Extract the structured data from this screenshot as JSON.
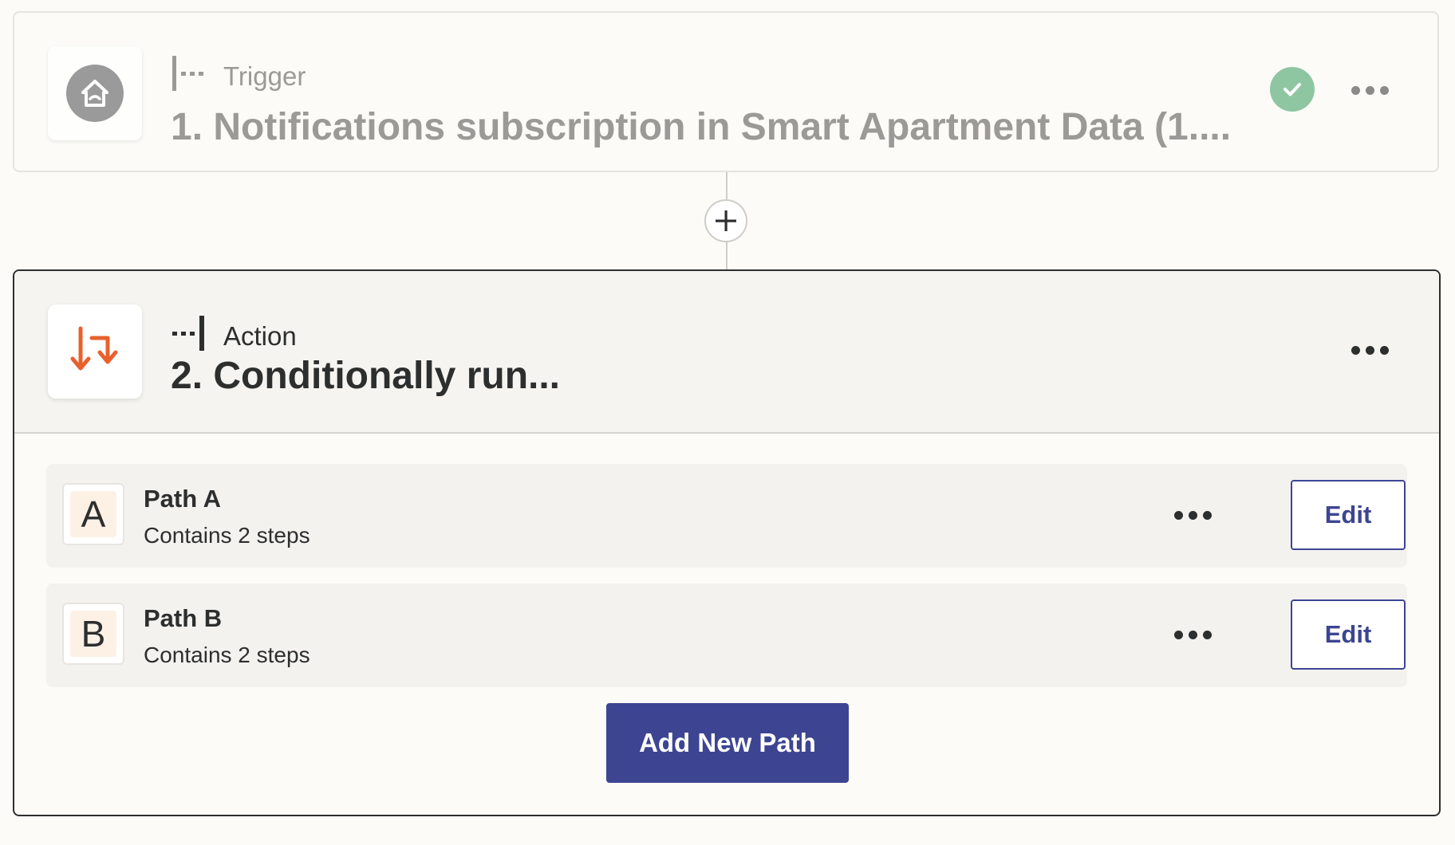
{
  "trigger": {
    "kind_label": "Trigger",
    "title": "1. Notifications subscription in Smart Apartment Data (1....",
    "app_icon": "home-icon",
    "status": "complete",
    "status_color": "#8fc6a2"
  },
  "connector": {
    "add_icon": "plus-icon"
  },
  "action": {
    "kind_label": "Action",
    "title": "2. Conditionally run...",
    "app_icon": "paths-icon",
    "app_color": "#e8612c"
  },
  "paths": [
    {
      "letter": "A",
      "name": "Path A",
      "summary": "Contains 2 steps",
      "edit_label": "Edit"
    },
    {
      "letter": "B",
      "name": "Path B",
      "summary": "Contains 2 steps",
      "edit_label": "Edit"
    }
  ],
  "add_path_label": "Add New Path",
  "colors": {
    "accent": "#3d4592",
    "text": "#2d2e2e",
    "muted": "#9c9a96"
  }
}
